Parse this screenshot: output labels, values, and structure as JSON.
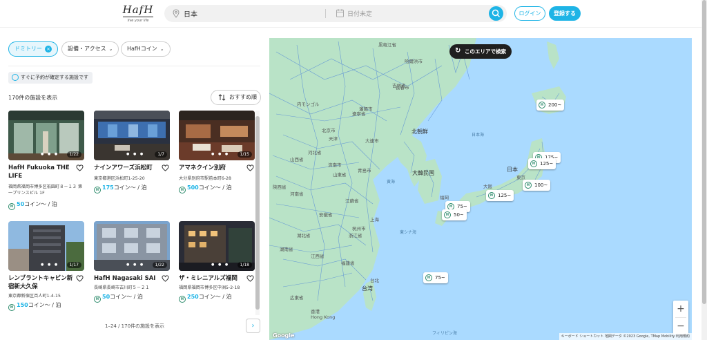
{
  "header": {
    "logo_text": "HafH",
    "logo_tagline": "live your life",
    "search_place": "日本",
    "search_date_placeholder": "日付未定",
    "login_label": "ログイン",
    "signup_label": "登録する"
  },
  "filters": {
    "chips": [
      {
        "label": "ドミトリー",
        "active": true
      },
      {
        "label": "設備・アクセス",
        "active": false
      },
      {
        "label": "HafHコイン",
        "active": false
      }
    ],
    "instant_badge": "すぐに予約が確定する施設です"
  },
  "results": {
    "count_text": "170件の施設を表示",
    "sort_label": "おすすめ順",
    "pager_text": "1–24 / 170件の施設を表示",
    "next_label": "›",
    "coin_unit": "コイン～ / 泊",
    "cards": [
      {
        "name": "HafH Fukuoka THE LIFE",
        "address": "福岡県福岡市博多区祇園町８－１３ 第一プリンスビル 1F",
        "coins": "50",
        "page": "1/22"
      },
      {
        "name": "ナインアワーズ浜松町",
        "address": "東京都港区浜松町1-25-20",
        "coins": "175",
        "page": "1/7"
      },
      {
        "name": "アマネクイン別府",
        "address": "大分県別府市駅前本町6-28",
        "coins": "500",
        "page": "1/15"
      },
      {
        "name": "レンブラントキャビン新宿新大久保",
        "address": "東京都新宿区百人町1-4-15",
        "coins": "150",
        "page": "1/17"
      },
      {
        "name": "HafH Nagasaki SAI",
        "address": "長崎県長崎市古川町５－２１",
        "coins": "50",
        "page": "1/22"
      },
      {
        "name": "ザ・ミレニアルズ福岡",
        "address": "福岡県福岡市博多区中洲5-2-18",
        "coins": "250",
        "page": "1/18"
      }
    ]
  },
  "map": {
    "search_area_label": "このエリアで検索",
    "pins": [
      {
        "label": "200~"
      },
      {
        "label": "175~"
      },
      {
        "label": "125~"
      },
      {
        "label": "100~"
      },
      {
        "label": "125~"
      },
      {
        "label": "75~"
      },
      {
        "label": "50~"
      },
      {
        "label": "75~"
      }
    ],
    "place_labels": [
      "黒竜江省",
      "哈爾浜市",
      "吉林省",
      "長春市",
      "遼寧省",
      "瀋陽市",
      "北朝鮮",
      "大連市",
      "北京市",
      "天津",
      "河北省",
      "山東省",
      "済南市",
      "青島市",
      "黄海",
      "大韓民国",
      "日本海",
      "日本",
      "東京",
      "大阪",
      "福岡",
      "江蘇省",
      "上海",
      "浙江省",
      "杭州市",
      "東シナ海",
      "湖南省",
      "江西省",
      "福建省",
      "台湾",
      "広東省",
      "香港",
      "Hong Kong",
      "フィリピン海",
      "安徽省",
      "河南省",
      "湖北省",
      "山西省",
      "陝西省",
      "内モンゴル",
      "台北"
    ],
    "zoom_in": "+",
    "zoom_out": "−",
    "google": "Google",
    "attribution": "キーボード ショートカット   地図データ ©2023 Google, TMap Mobility   利用規約"
  },
  "colors": {
    "accent": "#1eb4e6",
    "sea": "#aadaff",
    "land": "#b9e3c7",
    "roads": "#5b8fd6"
  }
}
